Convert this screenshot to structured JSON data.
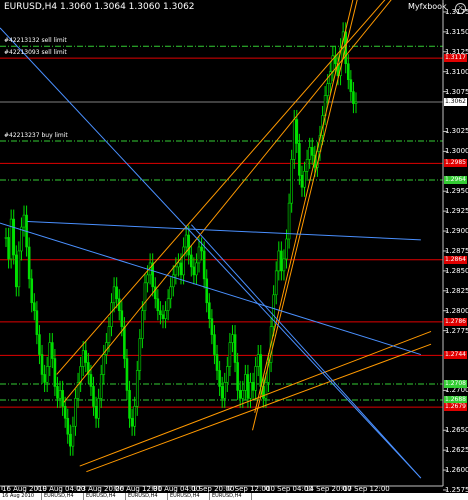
{
  "title": "EURUSD,H4  1.3060 1.3064 1.3060 1.3062",
  "watermark": "Myfxbook",
  "chart_data": {
    "type": "candlestick",
    "symbol": "EURUSD",
    "timeframe": "H4",
    "ohlc_current": [
      1.306,
      1.3064,
      1.306,
      1.3062
    ],
    "ylim": [
      1.258,
      1.319
    ],
    "y_ticks": [
      {
        "value": 1.3175,
        "label": "1.3175"
      },
      {
        "value": 1.315,
        "label": "1.3150"
      },
      {
        "value": 1.3125,
        "label": "1.3125"
      },
      {
        "value": 1.31,
        "label": "1.3100"
      },
      {
        "value": 1.3075,
        "label": "1.3075"
      },
      {
        "value": 1.3025,
        "label": "1.3025"
      },
      {
        "value": 1.3,
        "label": "1.3000"
      },
      {
        "value": 1.295,
        "label": "1.2950"
      },
      {
        "value": 1.2925,
        "label": "1.2925"
      },
      {
        "value": 1.29,
        "label": "1.2900"
      },
      {
        "value": 1.2875,
        "label": "1.2875"
      },
      {
        "value": 1.285,
        "label": "1.2850"
      },
      {
        "value": 1.2825,
        "label": "1.2825"
      },
      {
        "value": 1.28,
        "label": "1.2800"
      },
      {
        "value": 1.2775,
        "label": "1.2775"
      },
      {
        "value": 1.27,
        "label": "1.2700"
      },
      {
        "value": 1.265,
        "label": "1.2650"
      },
      {
        "value": 1.2625,
        "label": "1.2625"
      },
      {
        "value": 1.26,
        "label": "1.2600"
      },
      {
        "value": 1.2575,
        "label": "1.2575"
      }
    ],
    "x_labels": [
      "16 Aug 2010",
      "19 Aug 04:00",
      "23 Aug 20:00",
      "26 Aug 12:00",
      "31 Aug 04:00",
      "1 Sep 20:00",
      "7 Sep 12:00",
      "10 Sep 04:00",
      "14 Sep 20:00",
      "17 Sep 12:00"
    ],
    "current_price": {
      "value": 1.3062,
      "label": "1.3062"
    },
    "horizontal_levels": [
      {
        "value": 1.3132,
        "style": "dash-dot",
        "color": "#33cc33",
        "label": ""
      },
      {
        "value": 1.3117,
        "style": "solid",
        "color": "#e00000",
        "label": "1.3117"
      },
      {
        "value": 1.3013,
        "style": "dash-dot",
        "color": "#33cc33",
        "label": ""
      },
      {
        "value": 1.2985,
        "style": "solid",
        "color": "#e00000",
        "label": "1.2985"
      },
      {
        "value": 1.2964,
        "style": "dash-dot",
        "color": "#33cc33",
        "label": "1.2964"
      },
      {
        "value": 1.2864,
        "style": "solid",
        "color": "#e00000",
        "label": "1.2864"
      },
      {
        "value": 1.2786,
        "style": "solid",
        "color": "#e00000",
        "label": "1.2786"
      },
      {
        "value": 1.2744,
        "style": "solid",
        "color": "#e00000",
        "label": "1.2744"
      },
      {
        "value": 1.2708,
        "style": "dash-dot",
        "color": "#33cc33",
        "label": "1.2708"
      },
      {
        "value": 1.2688,
        "style": "dash-dot",
        "color": "#33cc33",
        "label": "1.2688"
      },
      {
        "value": 1.2679,
        "style": "solid",
        "color": "#e00000",
        "label": "1.2679"
      }
    ],
    "orders": [
      {
        "text": "#42213132 sell limit",
        "value": 1.3132
      },
      {
        "text": "#42213093 sell limit",
        "value": 1.3117
      },
      {
        "text": "#42213237 buy limit",
        "value": 1.3013
      }
    ],
    "candles": [
      1.2892,
      1.2865,
      1.2915,
      1.287,
      1.283,
      1.2875,
      1.2905,
      1.292,
      1.288,
      1.284,
      1.281,
      1.28,
      1.277,
      1.2745,
      1.272,
      1.271,
      1.273,
      1.276,
      1.274,
      1.2705,
      1.269,
      1.27,
      1.268,
      1.2665,
      1.2645,
      1.263,
      1.2655,
      1.269,
      1.271,
      1.273,
      1.275,
      1.2735,
      1.272,
      1.2705,
      1.268,
      1.2665,
      1.269,
      1.272,
      1.2745,
      1.276,
      1.278,
      1.281,
      1.283,
      1.2815,
      1.28,
      1.278,
      1.274,
      1.27,
      1.2665,
      1.2655,
      1.268,
      1.2725,
      1.2765,
      1.28,
      1.2835,
      1.2845,
      1.286,
      1.283,
      1.2815,
      1.28,
      1.2795,
      1.279,
      1.28,
      1.2815,
      1.283,
      1.2845,
      1.2855,
      1.286,
      1.2845,
      1.288,
      1.2895,
      1.287,
      1.2855,
      1.2845,
      1.286,
      1.288,
      1.2875,
      1.284,
      1.281,
      1.279,
      1.277,
      1.2745,
      1.2725,
      1.2705,
      1.269,
      1.271,
      1.273,
      1.276,
      1.277,
      1.2735,
      1.27,
      1.269,
      1.27,
      1.272,
      1.269,
      1.271,
      1.27,
      1.273,
      1.2745,
      1.2705,
      1.269,
      1.271,
      1.2735,
      1.278,
      1.282,
      1.285,
      1.2875,
      1.285,
      1.2865,
      1.289,
      1.2935,
      1.299,
      1.304,
      1.301,
      1.297,
      1.2955,
      1.2975,
      1.299,
      1.3005,
      1.2995,
      1.298,
      1.3,
      1.302,
      1.3045,
      1.307,
      1.3085,
      1.31,
      1.312,
      1.311,
      1.3095,
      1.313,
      1.315,
      1.311,
      1.309,
      1.3075,
      1.306,
      1.3062
    ],
    "trendlines": [
      {
        "color": "#ff9900",
        "from": [
          0.128,
          1.272
        ],
        "to": [
          0.9,
          1.321
        ]
      },
      {
        "color": "#ff9900",
        "from": [
          0.144,
          1.2685
        ],
        "to": [
          0.912,
          1.321
        ]
      },
      {
        "color": "#ff9900",
        "from": [
          0.18,
          1.2605
        ],
        "to": [
          0.973,
          1.2774
        ]
      },
      {
        "color": "#ff9900",
        "from": [
          0.195,
          1.2598
        ],
        "to": [
          0.973,
          1.2758
        ]
      },
      {
        "color": "#ff9900",
        "from": [
          0.57,
          1.265
        ],
        "to": [
          0.815,
          1.321
        ]
      },
      {
        "color": "#ff9900",
        "from": [
          0.575,
          1.2672
        ],
        "to": [
          0.805,
          1.321
        ]
      },
      {
        "color": "#4a90ff",
        "from": [
          0.062,
          1.2912
        ],
        "to": [
          0.95,
          1.2889
        ]
      },
      {
        "color": "#4a90ff",
        "from": [
          0.0,
          1.291
        ],
        "to": [
          0.95,
          1.2745
        ]
      },
      {
        "color": "#4a90ff",
        "from": [
          0.0,
          1.3155
        ],
        "to": [
          0.95,
          1.259
        ]
      },
      {
        "color": "#4a90ff",
        "from": [
          0.432,
          1.2908
        ],
        "to": [
          0.95,
          1.259
        ]
      }
    ]
  },
  "tabs": [
    "16 Aug 2010",
    "EURUSD,H4",
    "EURUSD,H4",
    "EURUSD,H4",
    "EURUSD,H4",
    "EURUSD,H4"
  ]
}
